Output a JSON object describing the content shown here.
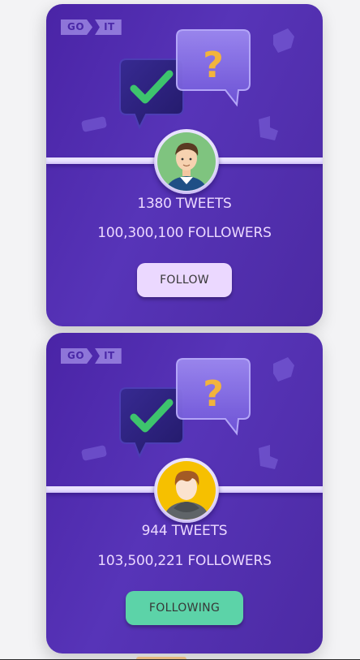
{
  "cards": [
    {
      "logo": {
        "part1": "GO",
        "part2": "IT"
      },
      "tweets_text": "1380 TWEETS",
      "followers_text": "100,300,100 FOLLOWERS",
      "button_label": "FOLLOW",
      "avatar": "male-user-avatar-icon"
    },
    {
      "logo": {
        "part1": "GO",
        "part2": "IT"
      },
      "tweets_text": "944 TWEETS",
      "followers_text": "103,500,221 FOLLOWERS",
      "button_label": "FOLLOWING",
      "avatar": "hooded-user-avatar-icon"
    }
  ],
  "colors": {
    "card_bg": "#4a24a6",
    "text": "#ebd8ff",
    "follow_button": "#ebd8ff",
    "following_button": "#5cd3a8",
    "button_text": "#373737"
  }
}
